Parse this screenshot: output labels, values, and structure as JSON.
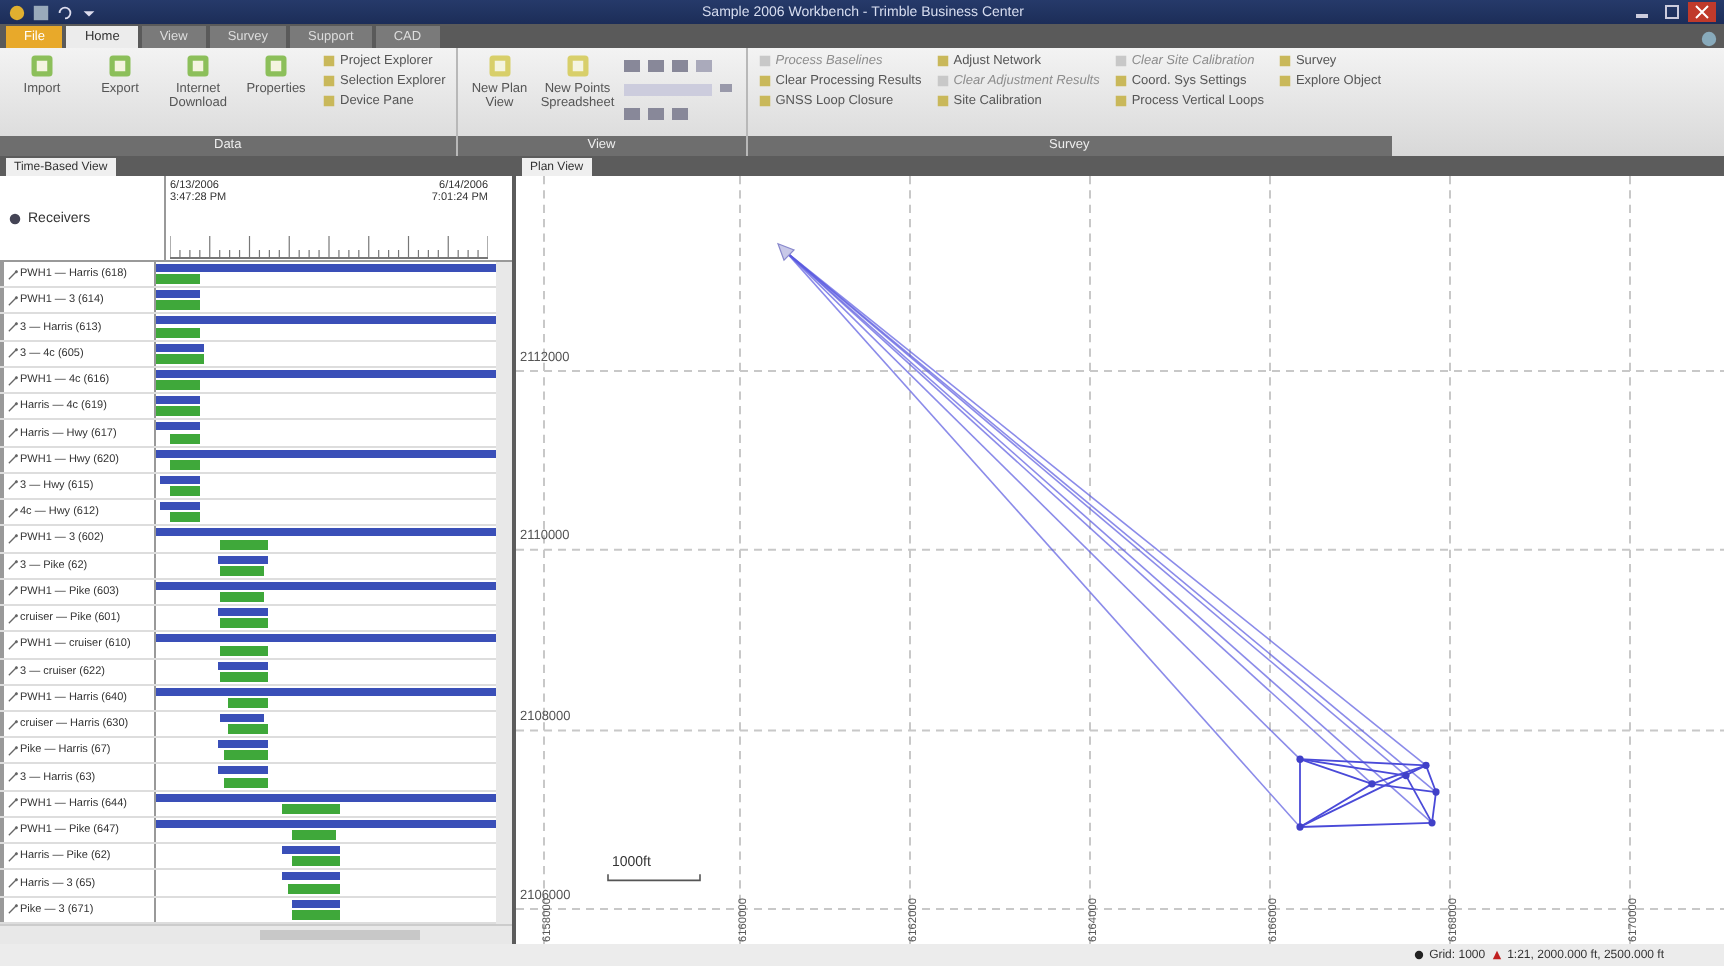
{
  "window": {
    "title": "Sample 2006 Workbench - Trimble Business Center"
  },
  "ribbon": {
    "tabs": [
      {
        "label": "File",
        "kind": "file",
        "selected": false
      },
      {
        "label": "Home",
        "kind": "tab",
        "selected": true
      },
      {
        "label": "View",
        "kind": "tab",
        "selected": false
      },
      {
        "label": "Survey",
        "kind": "tab",
        "selected": false
      },
      {
        "label": "Support",
        "kind": "tab",
        "selected": false
      },
      {
        "label": "CAD",
        "kind": "tab",
        "selected": false
      }
    ],
    "groups": [
      {
        "label": "Data",
        "items": [
          {
            "kind": "large",
            "label": "Import"
          },
          {
            "kind": "large",
            "label": "Export"
          },
          {
            "kind": "large",
            "label": "Internet Download"
          },
          {
            "kind": "large",
            "label": "Properties"
          },
          {
            "kind": "small",
            "label": "Project Explorer",
            "disabled": false
          },
          {
            "kind": "small",
            "label": "Selection Explorer",
            "disabled": false
          },
          {
            "kind": "small",
            "label": "Device Pane",
            "disabled": false
          }
        ]
      },
      {
        "label": "View",
        "items": [
          {
            "kind": "large",
            "label": "New Plan View"
          },
          {
            "kind": "large",
            "label": "New Points Spreadsheet"
          },
          {
            "kind": "tools"
          }
        ]
      },
      {
        "label": "Survey",
        "items": [
          {
            "kind": "small",
            "label": "Process Baselines",
            "disabled": true
          },
          {
            "kind": "small",
            "label": "Clear Processing Results",
            "disabled": false
          },
          {
            "kind": "small",
            "label": "GNSS Loop Closure",
            "disabled": false
          },
          {
            "kind": "small",
            "label": "Adjust Network",
            "disabled": false
          },
          {
            "kind": "small",
            "label": "Clear Adjustment Results",
            "disabled": true
          },
          {
            "kind": "small",
            "label": "Site Calibration",
            "disabled": false
          },
          {
            "kind": "small",
            "label": "Clear Site Calibration",
            "disabled": true
          },
          {
            "kind": "small",
            "label": "Coord. Sys Settings",
            "disabled": false
          },
          {
            "kind": "small",
            "label": "Process Vertical Loops",
            "disabled": false
          },
          {
            "kind": "small",
            "label": "Survey",
            "disabled": false
          },
          {
            "kind": "small",
            "label": "Explore Object",
            "disabled": false
          }
        ]
      }
    ]
  },
  "timeline": {
    "tab": "Time-Based View",
    "column_header": "Receivers",
    "start_date": "6/13/2006",
    "start_time": "3:47:28 PM",
    "end_date": "6/14/2006",
    "end_time": "7:01:24 PM",
    "rows": [
      {
        "label": "PWH1 — Harris (618)"
      },
      {
        "label": "PWH1 — 3 (614)"
      },
      {
        "label": "3 — Harris (613)"
      },
      {
        "label": "3 — 4c (605)"
      },
      {
        "label": "PWH1 — 4c (616)"
      },
      {
        "label": "Harris — 4c (619)"
      },
      {
        "label": "Harris — Hwy (617)"
      },
      {
        "label": "PWH1 — Hwy (620)"
      },
      {
        "label": "3 — Hwy (615)"
      },
      {
        "label": "4c — Hwy (612)"
      },
      {
        "label": "PWH1 — 3 (602)"
      },
      {
        "label": "3 — Pike (62)"
      },
      {
        "label": "PWH1 — Pike (603)"
      },
      {
        "label": "cruiser — Pike (601)"
      },
      {
        "label": "PWH1 — cruiser (610)"
      },
      {
        "label": "3 — cruiser (622)"
      },
      {
        "label": "PWH1 — Harris (640)"
      },
      {
        "label": "cruiser — Harris (630)"
      },
      {
        "label": "Pike — Harris (67)"
      },
      {
        "label": "3 — Harris (63)"
      },
      {
        "label": "PWH1 — Harris (644)"
      },
      {
        "label": "PWH1 — Pike (647)"
      },
      {
        "label": "Harris — Pike (62)"
      },
      {
        "label": "Harris — 3 (65)"
      },
      {
        "label": "Pike — 3 (671)"
      }
    ]
  },
  "plan": {
    "tab": "Plan View",
    "y_labels": [
      "2112000",
      "2110000",
      "2108000",
      "2106000"
    ],
    "x_labels": [
      "6158000",
      "6160000",
      "6162000",
      "6164000",
      "6166000",
      "6168000",
      "6170000"
    ],
    "scale": "1000ft"
  },
  "status_bar": {
    "items": [
      "Grid: 1000",
      "1:21, 2000.000 ft, 2500.000 ft"
    ]
  }
}
